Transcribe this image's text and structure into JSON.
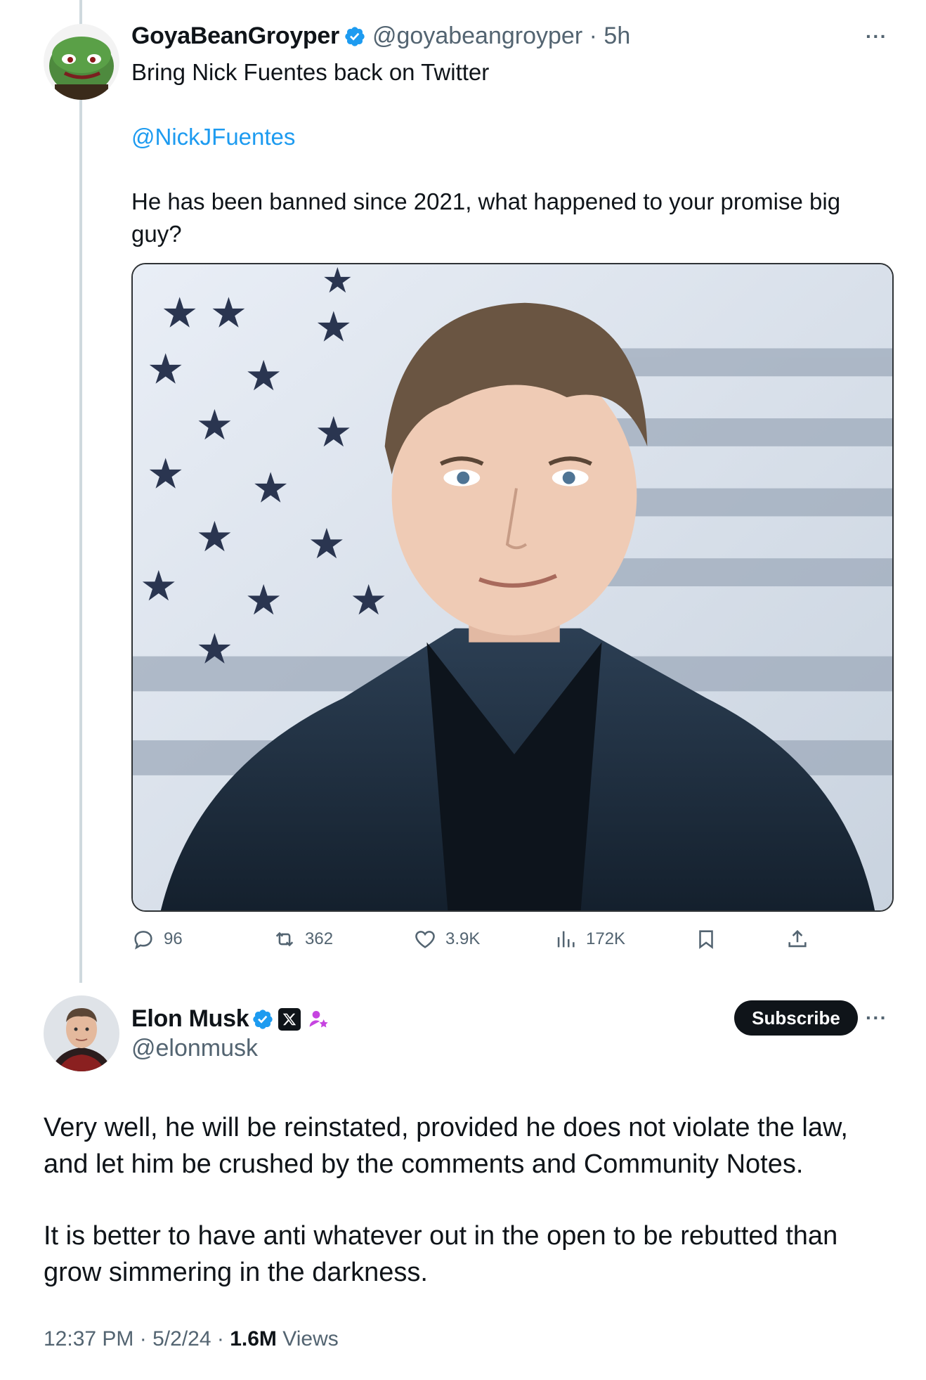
{
  "tweet1": {
    "display_name": "GoyaBeanGroyper",
    "handle": "@goyabeangroyper",
    "separator": "·",
    "time": "5h",
    "line1": "Bring Nick Fuentes back on Twitter",
    "mention": "@NickJFuentes",
    "line3a": "He has been banned since 2021, what happened to your promise big",
    "line3b": "guy?",
    "stats": {
      "replies": "96",
      "reposts": "362",
      "likes": "3.9K",
      "views": "172K"
    },
    "more": "···"
  },
  "tweet2": {
    "display_name": "Elon Musk",
    "handle": "@elonmusk",
    "subscribe_label": "Subscribe",
    "more": "···",
    "para1_l1": "Very well, he will be reinstated, provided he does not violate the law,",
    "para1_l2": "and let him be crushed by the comments and Community Notes.",
    "para2_l1": "It is better to have anti whatever out in the open to be rebutted than",
    "para2_l2": "grow simmering in the darkness.",
    "time": "12:37 PM",
    "dot": "·",
    "date": "5/2/24",
    "views_count": "1.6M",
    "views_label": "Views"
  },
  "colors": {
    "accent": "#1d9bf0",
    "muted": "#536471",
    "thread": "#cfd9de",
    "badge_purple": "#c644e0"
  },
  "icons": [
    "verified-badge-icon",
    "x-affiliate-icon",
    "subscriber-star-icon",
    "reply-icon",
    "repost-icon",
    "like-icon",
    "views-icon",
    "bookmark-icon",
    "share-icon",
    "more-icon"
  ]
}
